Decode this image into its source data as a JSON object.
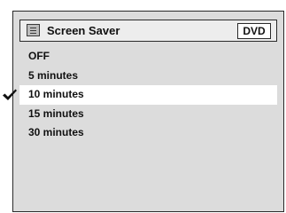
{
  "header": {
    "title": "Screen Saver",
    "badge": "DVD",
    "icon": "menu-list-icon"
  },
  "options": [
    {
      "label": "OFF",
      "selected": false
    },
    {
      "label": "5 minutes",
      "selected": false
    },
    {
      "label": "10 minutes",
      "selected": true
    },
    {
      "label": "15 minutes",
      "selected": false
    },
    {
      "label": "30 minutes",
      "selected": false
    }
  ],
  "colors": {
    "panel_bg": "#dcdcdc",
    "header_bg": "#ededed",
    "highlight_bg": "#ffffff",
    "text": "#111111",
    "border": "#2a2a2a"
  }
}
